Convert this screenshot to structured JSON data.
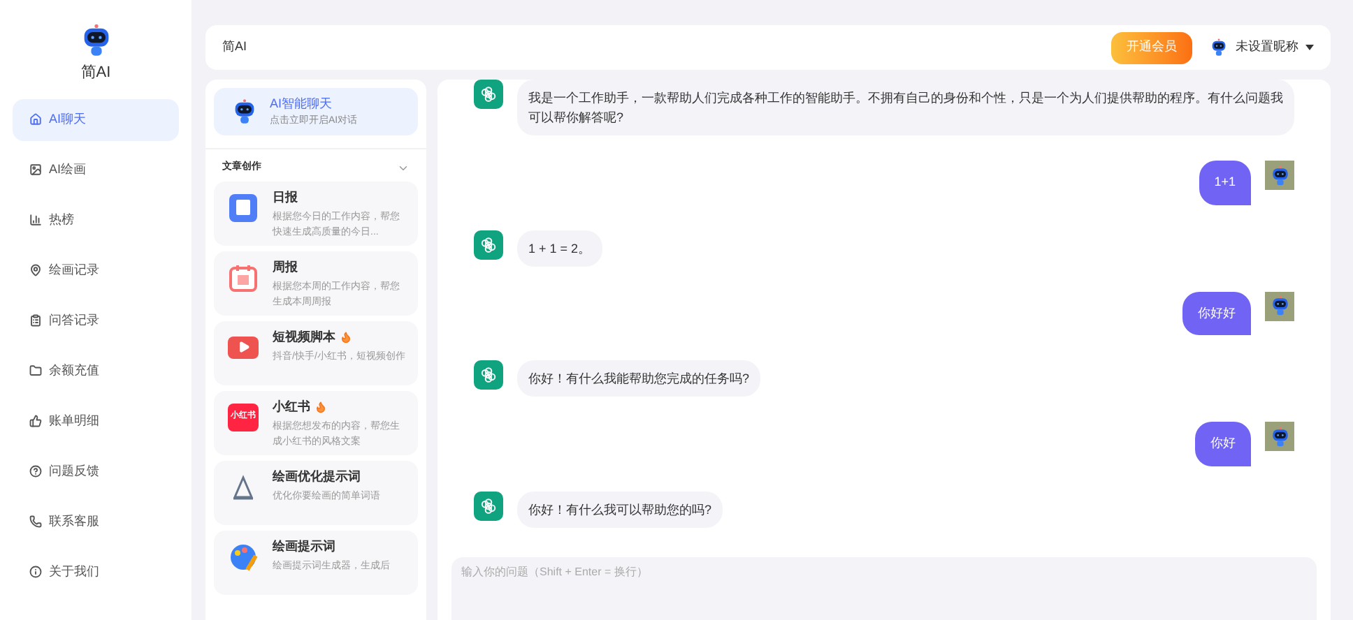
{
  "brand": {
    "name": "简AI"
  },
  "sidebar": {
    "items": [
      {
        "label": "AI聊天",
        "selected": true
      },
      {
        "label": "AI绘画",
        "selected": false
      },
      {
        "label": "热榜",
        "selected": false
      },
      {
        "label": "绘画记录",
        "selected": false
      },
      {
        "label": "问答记录",
        "selected": false
      },
      {
        "label": "余额充值",
        "selected": false
      },
      {
        "label": "账单明细",
        "selected": false
      },
      {
        "label": "问题反馈",
        "selected": false
      },
      {
        "label": "联系客服",
        "selected": false
      },
      {
        "label": "关于我们",
        "selected": false
      }
    ]
  },
  "header": {
    "title": "简AI",
    "vip_button": "开通会员",
    "user_name": "未设置昵称"
  },
  "panel": {
    "chat_entry": {
      "title": "AI智能聊天",
      "subtitle": "点击立即开启AI对话",
      "selected": true
    },
    "section": {
      "title": "文章创作",
      "expanded": true
    },
    "cards": [
      {
        "title": "日报",
        "hot": false,
        "description": "根据您今日的工作内容，帮您快速生成高质量的今日..."
      },
      {
        "title": "周报",
        "hot": false,
        "description": "根据您本周的工作内容，帮您生成本周周报"
      },
      {
        "title": "短视频脚本",
        "hot": true,
        "description": "抖音/快手/小红书，短视频创作"
      },
      {
        "title": "小红书",
        "hot": true,
        "description": "根据您想发布的内容，帮您生成小红书的风格文案",
        "icon_text": "小红书"
      },
      {
        "title": "绘画优化提示词",
        "hot": false,
        "description": "优化你要绘画的简单词语"
      },
      {
        "title": "绘画提示词",
        "hot": false,
        "description": "绘画提示词生成器，生成后"
      }
    ]
  },
  "chat": {
    "messages": [
      {
        "kind": "assistant",
        "text": "我是一个工作助手，一款帮助人们完成各种工作的智能助手。不拥有自己的身份和个性，只是一个为人们提供帮助的程序。有什么问题我可以帮你解答呢?"
      },
      {
        "kind": "user",
        "text": "1+1"
      },
      {
        "kind": "assistant",
        "text": "1 + 1 = 2。"
      },
      {
        "kind": "user",
        "text": "你好好"
      },
      {
        "kind": "assistant",
        "text": "你好！有什么我能帮助您完成的任务吗?"
      },
      {
        "kind": "user",
        "text": "你好"
      },
      {
        "kind": "assistant",
        "text": "你好！有什么我可以帮助您的吗?"
      }
    ],
    "input": {
      "placeholder": "输入你的问题（Shift + Enter = 换行）"
    }
  }
}
